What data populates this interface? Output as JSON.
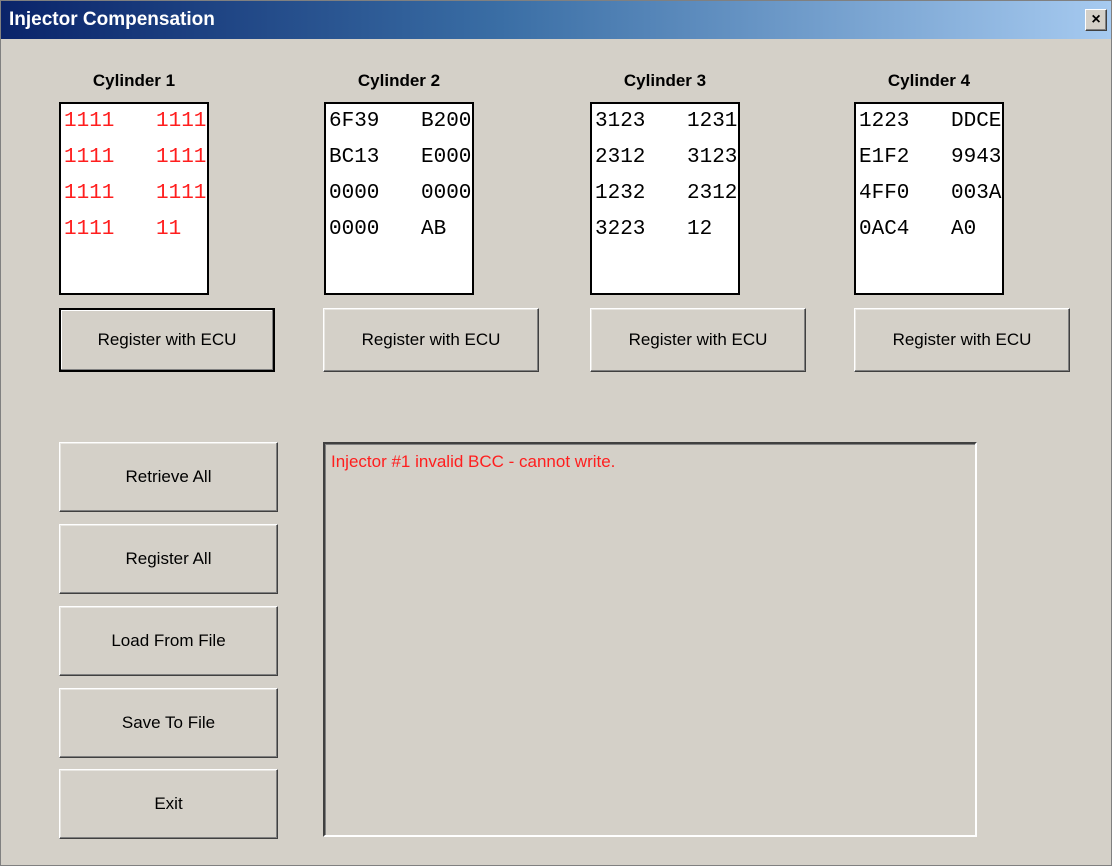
{
  "window": {
    "title": "Injector Compensation",
    "close_label": "×"
  },
  "cylinders": [
    {
      "label": "Cylinder 1",
      "text_color": "#ff1e1e",
      "rows": [
        [
          "1111",
          "1111"
        ],
        [
          "1111",
          "1111"
        ],
        [
          "1111",
          "1111"
        ],
        [
          "1111",
          "11"
        ]
      ],
      "button_label": "Register with ECU"
    },
    {
      "label": "Cylinder 2",
      "text_color": "#000000",
      "rows": [
        [
          "6F39",
          "B200"
        ],
        [
          "BC13",
          "E000"
        ],
        [
          "0000",
          "0000"
        ],
        [
          "0000",
          "AB"
        ]
      ],
      "button_label": "Register with ECU"
    },
    {
      "label": "Cylinder 3",
      "text_color": "#000000",
      "rows": [
        [
          "3123",
          "1231"
        ],
        [
          "2312",
          "3123"
        ],
        [
          "1232",
          "2312"
        ],
        [
          "3223",
          "12"
        ]
      ],
      "button_label": "Register with ECU"
    },
    {
      "label": "Cylinder 4",
      "text_color": "#000000",
      "rows": [
        [
          "1223",
          "DDCE"
        ],
        [
          "E1F2",
          "9943"
        ],
        [
          "4FF0",
          "003A"
        ],
        [
          "0AC4",
          "A0"
        ]
      ],
      "button_label": "Register with ECU"
    }
  ],
  "actions": {
    "retrieve_all": "Retrieve All",
    "register_all": "Register All",
    "load_from_file": "Load From File",
    "save_to_file": "Save To File",
    "exit": "Exit"
  },
  "log": {
    "message": "Injector #1 invalid BCC - cannot write.",
    "message_color": "#ff1e1e"
  },
  "colors": {
    "dialog_bg": "#d4d0c8",
    "title_gradient_start": "#0a246a",
    "title_gradient_end": "#a6caf0"
  }
}
